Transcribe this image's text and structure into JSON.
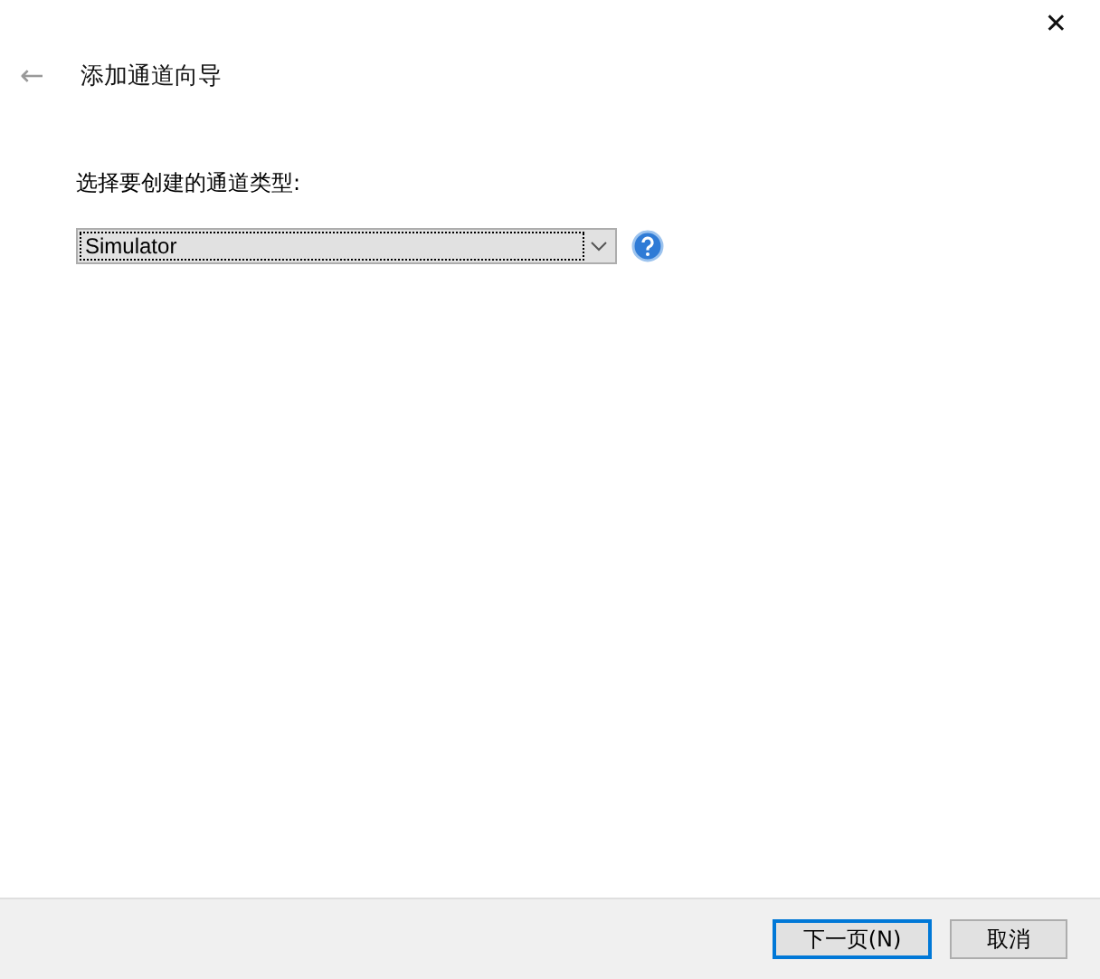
{
  "window": {
    "close": "✕"
  },
  "header": {
    "back": "←",
    "title": "添加通道向导"
  },
  "form": {
    "label": "选择要创建的通道类型:",
    "select": {
      "value": "Simulator"
    }
  },
  "buttons": [
    {
      "label": "下一页(N)",
      "kind": "default"
    },
    {
      "label": "取消",
      "kind": "normal"
    }
  ]
}
